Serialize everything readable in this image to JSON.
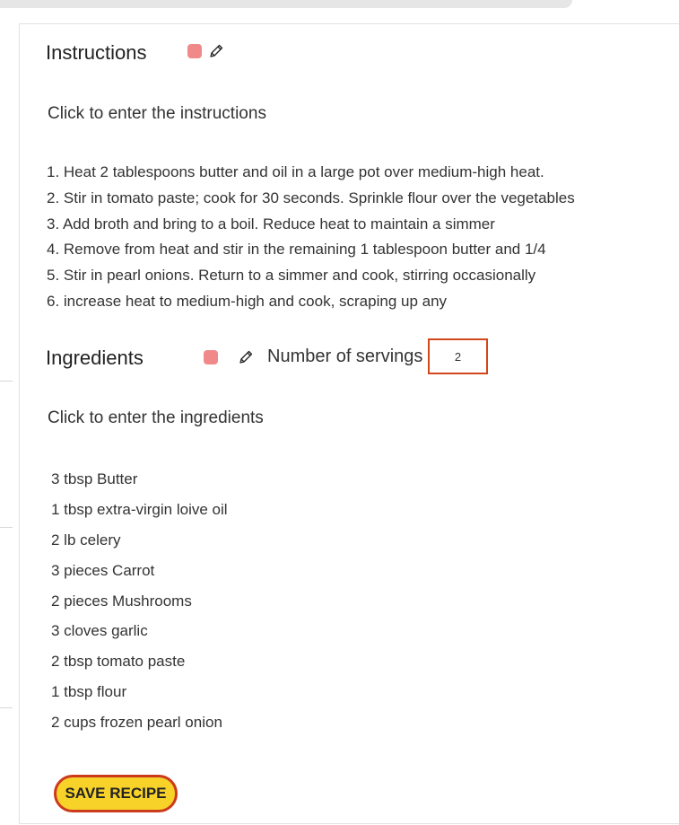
{
  "instructions": {
    "title": "Instructions",
    "placeholder": "Click to enter the instructions",
    "steps": [
      "1. Heat 2 tablespoons butter and oil in a large pot over medium-high heat.",
      "2. Stir in tomato paste; cook for 30 seconds. Sprinkle flour over the vegetables",
      "3. Add broth and bring to a boil. Reduce heat to maintain a simmer",
      "4. Remove from heat and stir in the remaining 1 tablespoon butter and 1/4",
      "5. Stir in pearl onions. Return to a simmer and cook, stirring occasionally",
      "6. increase heat to medium-high and cook, scraping up any"
    ]
  },
  "ingredients": {
    "title": "Ingredients",
    "servings_label": "Number of servings",
    "servings_value": "2",
    "placeholder": "Click to enter the ingredients",
    "items": [
      "3 tbsp Butter",
      "1 tbsp extra-virgin loive oil",
      "2 lb celery",
      "3 pieces Carrot",
      "2 pieces Mushrooms",
      "3 cloves garlic",
      "2 tbsp tomato paste",
      "1 tbsp flour",
      "2 cups frozen pearl onion"
    ]
  },
  "actions": {
    "save_label": "SAVE RECIPE"
  },
  "icons": {
    "color_swatch": "square-icon",
    "edit": "pencil-icon"
  },
  "colors": {
    "swatch": "#f08a8a",
    "save_button_bg": "#f7d32a",
    "save_button_border": "#cc3a1c",
    "servings_border": "#d2471b"
  }
}
